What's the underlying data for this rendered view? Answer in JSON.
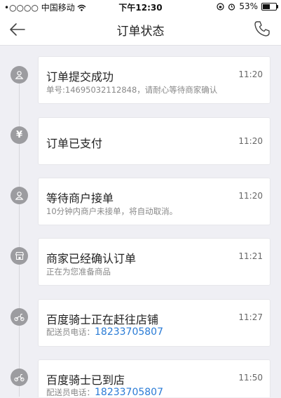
{
  "status_bar": {
    "carrier": "•○○○○ 中国移动",
    "time": "下午12:30",
    "battery_text": "53%",
    "battery_level": 0.53
  },
  "nav": {
    "title": "订单状态",
    "back_icon": "arrow-left-icon",
    "phone_icon": "phone-icon"
  },
  "events": [
    {
      "icon": "user-icon",
      "title": "订单提交成功",
      "time": "11:20",
      "desc": "单号:14695032112848，请耐心等待商家确认",
      "phone_label": "",
      "phone": ""
    },
    {
      "icon": "yen-icon",
      "title": "订单已支付",
      "time": "11:20",
      "desc": "",
      "phone_label": "",
      "phone": ""
    },
    {
      "icon": "user-icon",
      "title": "等待商户接单",
      "time": "11:20",
      "desc": "10分钟内商户未接单，将自动取消。",
      "phone_label": "",
      "phone": ""
    },
    {
      "icon": "store-icon",
      "title": "商家已经确认订单",
      "time": "11:21",
      "desc": "正在为您准备商品",
      "phone_label": "",
      "phone": ""
    },
    {
      "icon": "scooter-icon",
      "title": "百度骑士正在赶往店铺",
      "time": "11:27",
      "desc": "",
      "phone_label": "配送员电话：",
      "phone": "18233705807"
    },
    {
      "icon": "scooter-icon",
      "title": "百度骑士已到店",
      "time": "11:50",
      "desc": "",
      "phone_label": "配送员电话：",
      "phone": "18233705807"
    }
  ],
  "colors": {
    "background": "#efeff4",
    "icon_gray": "#9c9ca0",
    "link_blue": "#2a7bd6"
  }
}
